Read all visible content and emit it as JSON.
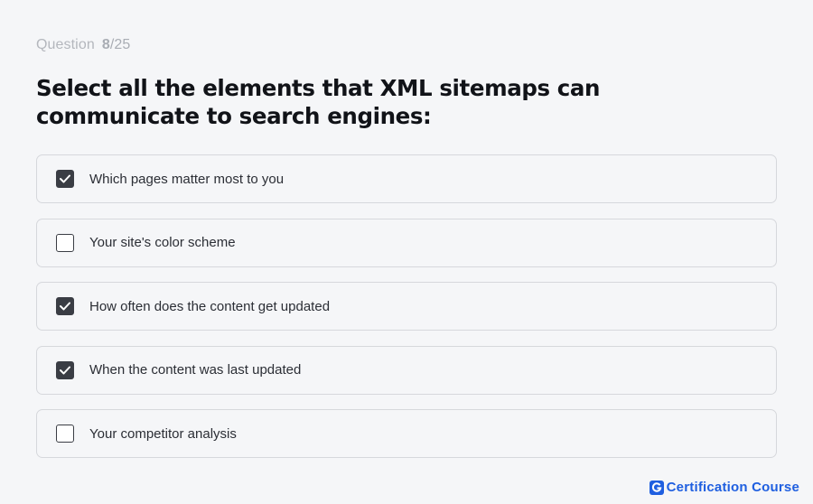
{
  "progress": {
    "label": "Question",
    "current": "8",
    "total": "/25"
  },
  "question": {
    "text": "Select all the elements that XML sitemaps can communicate to search engines:"
  },
  "options": [
    {
      "label": "Which pages matter most to you",
      "checked": true
    },
    {
      "label": "Your site's color scheme",
      "checked": false
    },
    {
      "label": "How often does the content get updated",
      "checked": true
    },
    {
      "label": "When the content was last updated",
      "checked": true
    },
    {
      "label": "Your competitor analysis",
      "checked": false
    }
  ],
  "brand": {
    "icon": "g-logo-icon",
    "name": "Certification Course",
    "color": "#1f5fe0"
  },
  "colors": {
    "checkbox_checked": "#3a3d44",
    "background": "#f5f6f8",
    "border": "#d6d8dc"
  }
}
